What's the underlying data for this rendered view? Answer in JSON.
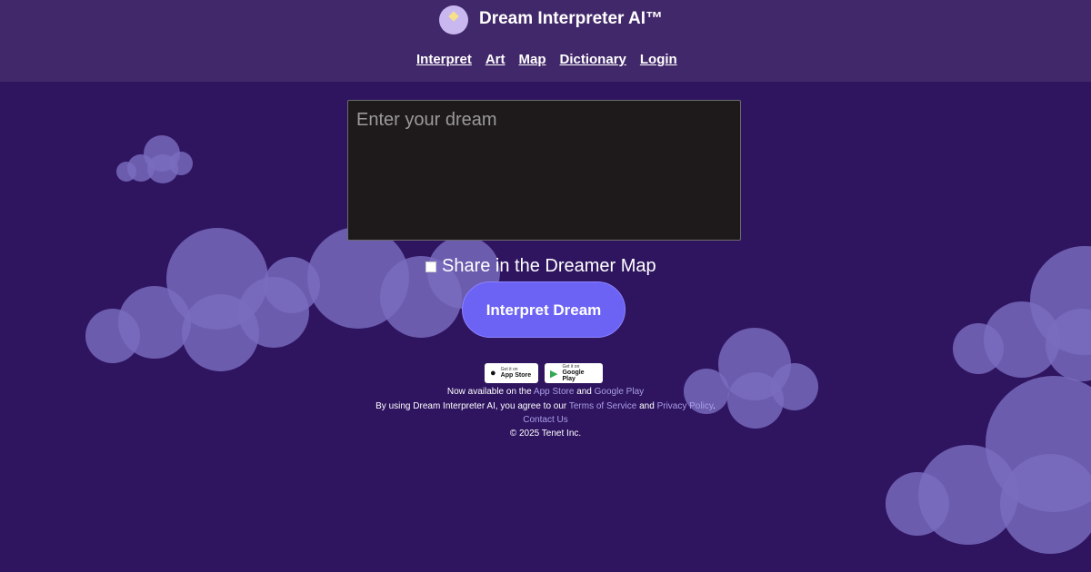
{
  "header": {
    "title": "Dream Interpreter AI™",
    "nav": [
      "Interpret",
      "Art",
      "Map",
      "Dictionary",
      "Login"
    ]
  },
  "form": {
    "placeholder": "Enter your dream",
    "share_label": "Share in the Dreamer Map",
    "submit_label": "Interpret Dream"
  },
  "stores": {
    "app_store": {
      "small": "Get it on",
      "big": "App Store",
      "icon": "apple-icon"
    },
    "google_play": {
      "small": "Get it on",
      "big": "Google Play",
      "icon": "google-play-icon"
    }
  },
  "footer": {
    "availability_prefix": "Now available on the",
    "app_store_link": "App Store",
    "and": "and",
    "google_play_link": "Google Play",
    "terms_prefix": "By using Dream Interpreter AI, you agree to our",
    "terms_link": "Terms of Service",
    "privacy_link": "Privacy Policy",
    "period": ".",
    "contact": "Contact Us",
    "copyright": "© 2025 Tenet Inc."
  },
  "colors": {
    "background": "#2f1560",
    "header": "#41286a",
    "button": "#6c63f5",
    "link": "#a99ee6"
  }
}
